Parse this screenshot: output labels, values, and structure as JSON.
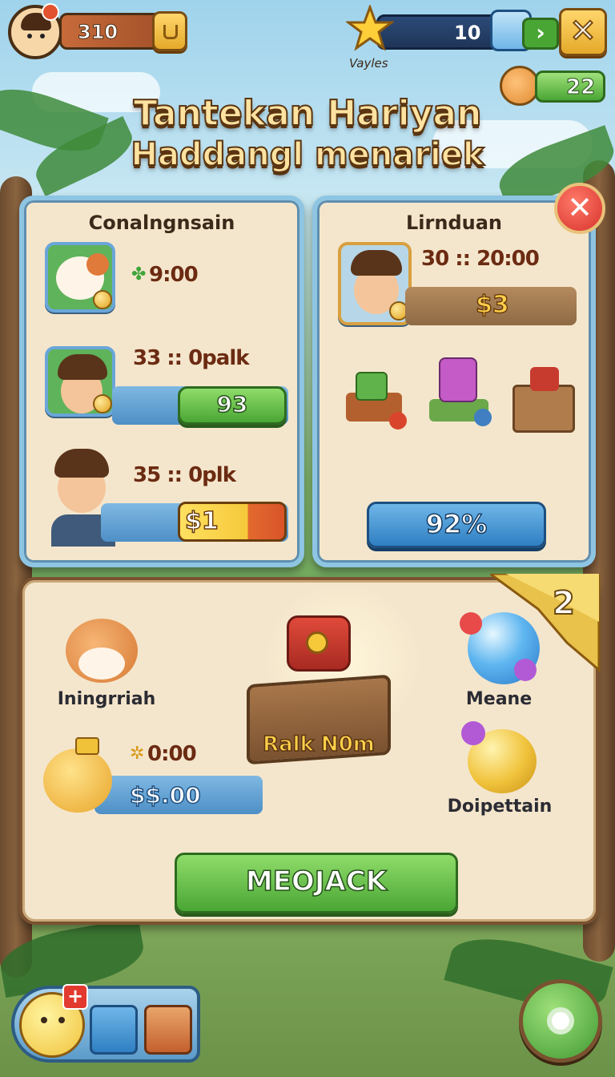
{
  "hud": {
    "coins": "310",
    "stars": "10",
    "star_caption": "Vayles",
    "pets": "22"
  },
  "title": {
    "line1": "Tantekan Hariyan",
    "line2": "Haddangl menariek"
  },
  "left_panel": {
    "title": "Conalngnsain",
    "rows": [
      {
        "timer": "9:00",
        "value": ""
      },
      {
        "timer": "33 :: 0palk",
        "value": "93"
      },
      {
        "timer": "35 :: 0plk",
        "value": "$1"
      }
    ]
  },
  "right_panel": {
    "title": "Lirnduan",
    "timer": "30 :: 20:00",
    "value": "$3",
    "progress_label": "92%",
    "progress": 0.92
  },
  "bottom_panel": {
    "ribbon": "2",
    "item_left_label": "Iningrriah",
    "chest_label": "Ralk N0m",
    "item_right_top_label": "Meane",
    "item_right_bottom_label": "Doipettain",
    "timer": "0:00",
    "value": "$$.00",
    "claim_button": "MEOJACK"
  },
  "colors": {
    "panel_border": "#8ec5e2",
    "panel_bg": "#f4e6cc",
    "green_button": "#4aa634",
    "blue_button": "#2f7fc2",
    "title_text": "#ffe2a0"
  }
}
